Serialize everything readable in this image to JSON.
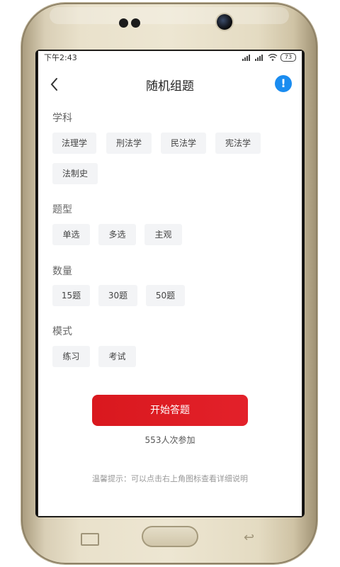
{
  "status_bar": {
    "time": "下午2:43",
    "battery": "73"
  },
  "header": {
    "title": "随机组题",
    "info_icon": "!"
  },
  "sections": {
    "subject": {
      "label": "学科",
      "options": [
        "法理学",
        "刑法学",
        "民法学",
        "宪法学",
        "法制史"
      ]
    },
    "type": {
      "label": "题型",
      "options": [
        "单选",
        "多选",
        "主观"
      ]
    },
    "count": {
      "label": "数量",
      "options": [
        "15题",
        "30题",
        "50题"
      ]
    },
    "mode": {
      "label": "模式",
      "options": [
        "练习",
        "考试"
      ]
    }
  },
  "start_button": "开始答题",
  "participants": "553人次参加",
  "tip": "温馨提示：可以点击右上角图标查看详细说明",
  "colors": {
    "primary": "#e3212a",
    "info": "#1a8cf0",
    "chip_bg": "#f3f4f6"
  }
}
